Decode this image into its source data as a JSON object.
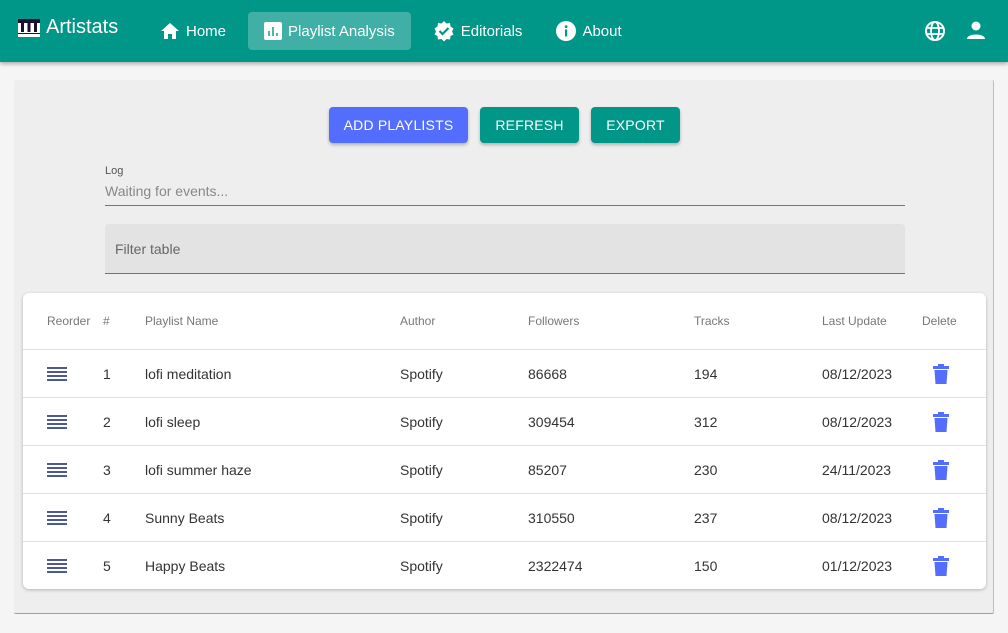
{
  "app": {
    "brand": "Artistats",
    "nav": [
      {
        "label": "Home",
        "icon": "home-icon",
        "active": false
      },
      {
        "label": "Playlist Analysis",
        "icon": "chart-icon",
        "active": true
      },
      {
        "label": "Editorials",
        "icon": "verified-badge-icon",
        "active": false
      },
      {
        "label": "About",
        "icon": "info-icon",
        "active": false
      }
    ],
    "right_icons": [
      "globe-icon",
      "user-icon"
    ],
    "colors": {
      "primary": "#009688",
      "accent": "#536dfe"
    }
  },
  "toolbar": {
    "add_label": "ADD PLAYLISTS",
    "refresh_label": "REFRESH",
    "export_label": "EXPORT"
  },
  "log": {
    "label": "Log",
    "value": "Waiting for events..."
  },
  "filter": {
    "placeholder": "Filter table",
    "value": ""
  },
  "table": {
    "headers": {
      "reorder": "Reorder",
      "num": "#",
      "name": "Playlist Name",
      "author": "Author",
      "followers": "Followers",
      "tracks": "Tracks",
      "date": "Last Update",
      "delete": "Delete"
    },
    "rows": [
      {
        "num": "1",
        "name": "lofi meditation",
        "author": "Spotify",
        "followers": "86668",
        "tracks": "194",
        "date": "08/12/2023"
      },
      {
        "num": "2",
        "name": "lofi sleep",
        "author": "Spotify",
        "followers": "309454",
        "tracks": "312",
        "date": "08/12/2023"
      },
      {
        "num": "3",
        "name": "lofi summer haze",
        "author": "Spotify",
        "followers": "85207",
        "tracks": "230",
        "date": "24/11/2023"
      },
      {
        "num": "4",
        "name": "Sunny Beats",
        "author": "Spotify",
        "followers": "310550",
        "tracks": "237",
        "date": "08/12/2023"
      },
      {
        "num": "5",
        "name": "Happy Beats",
        "author": "Spotify",
        "followers": "2322474",
        "tracks": "150",
        "date": "01/12/2023"
      }
    ]
  }
}
